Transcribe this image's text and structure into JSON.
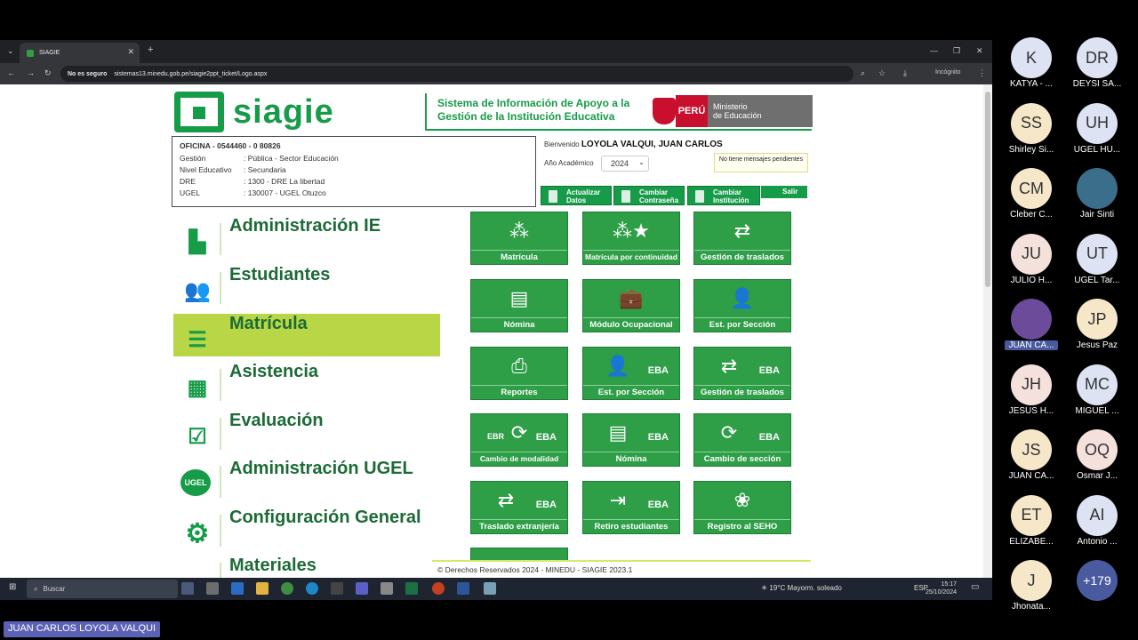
{
  "browser": {
    "tab_title": "SIAGIE",
    "not_secure": "No es seguro",
    "url": "sistemas13.minedu.gob.pe/siagie2ppt_ticket/Logo.aspx",
    "incognito": "Incógnito"
  },
  "header": {
    "logo": "siagie",
    "system_line1": "Sistema de Información de Apoyo a la",
    "system_line2": "Gestión de la Institución Educativa",
    "peru": "PERÚ",
    "ministry_line1": "Ministerio",
    "ministry_line2": "de Educación"
  },
  "office": {
    "title": "OFICINA - 0544460 - 0 80826",
    "rows": [
      {
        "k": "Gestión",
        "v": ": Pública - Sector Educación"
      },
      {
        "k": "Nivel Educativo",
        "v": ": Secundaria"
      },
      {
        "k": "DRE",
        "v": ": 1300 - DRE La libertad"
      },
      {
        "k": "UGEL",
        "v": ": 130007 - UGEL Otuzco"
      }
    ]
  },
  "user": {
    "welcome": "Bienvenido",
    "name": "LOYOLA VALQUI, JUAN CARLOS",
    "year_label": "Año Académico",
    "year": "2024",
    "messages": "No tiene mensajes pendientes"
  },
  "actions": {
    "update_1": "Actualizar",
    "update_2": "Datos",
    "pwd_1": "Cambiar",
    "pwd_2": "Contraseña",
    "inst_1": "Cambiar",
    "inst_2": "Institución",
    "exit": "Salir"
  },
  "menu": [
    {
      "label": "Administración IE",
      "icon": "school-icon"
    },
    {
      "label": "Estudiantes",
      "icon": "students-icon"
    },
    {
      "label": "Matrícula",
      "icon": "enrollment-icon"
    },
    {
      "label": "Asistencia",
      "icon": "attendance-icon"
    },
    {
      "label": "Evaluación",
      "icon": "evaluation-icon"
    },
    {
      "label": "Administración UGEL",
      "icon": "ugel-icon"
    },
    {
      "label": "Configuración General",
      "icon": "gear-icon"
    },
    {
      "label": "Materiales",
      "icon": "materials-icon"
    }
  ],
  "menu_badge": "UGEL",
  "tiles": [
    {
      "label": "Matrícula",
      "eba": ""
    },
    {
      "label": "Matrícula por continuidad",
      "eba": ""
    },
    {
      "label": "Gestión de traslados",
      "eba": ""
    },
    {
      "label": "Nómina",
      "eba": ""
    },
    {
      "label": "Módulo Ocupacional",
      "eba": ""
    },
    {
      "label": "Est. por Sección",
      "eba": ""
    },
    {
      "label": "Reportes",
      "eba": ""
    },
    {
      "label": "Est. por Sección",
      "eba": "EBA"
    },
    {
      "label": "Gestión de traslados",
      "eba": "EBA"
    },
    {
      "label": "Cambio de modalidad",
      "eba": "EBA",
      "ebr": "EBR"
    },
    {
      "label": "Nómina",
      "eba": "EBA"
    },
    {
      "label": "Cambio de sección",
      "eba": "EBA"
    },
    {
      "label": "Traslado extranjería",
      "eba": "EBA"
    },
    {
      "label": "Retiro estudiantes",
      "eba": "EBA"
    },
    {
      "label": "Registro al SEHO",
      "eba": ""
    }
  ],
  "footer": "© Derechos Reservados 2024 - MINEDU - SIAGIE 2023.1",
  "taskbar": {
    "search": "Buscar",
    "weather": "19°C  Mayorm. soleado",
    "lang": "ESP",
    "time": "15:17",
    "date": "25/10/2024"
  },
  "participants": [
    {
      "initials": "K",
      "name": "KATYA - ...",
      "color": "#dde3f3"
    },
    {
      "initials": "DR",
      "name": "DEYSI SA...",
      "color": "#dde3f3"
    },
    {
      "initials": "SS",
      "name": "Shirley Si...",
      "color": "#f6e7c8"
    },
    {
      "initials": "UH",
      "name": "UGEL HU...",
      "color": "#dde3f3"
    },
    {
      "initials": "CM",
      "name": "Cleber C...",
      "color": "#f6e7c8"
    },
    {
      "initials": "",
      "name": "Jair Sinti",
      "color": "#3b6e8a"
    },
    {
      "initials": "JU",
      "name": "JULIO H...",
      "color": "#f5e1dc"
    },
    {
      "initials": "UT",
      "name": "UGEL Tar...",
      "color": "#dde3f3"
    },
    {
      "initials": "",
      "name": "JUAN CA...",
      "color": "#6b4b9a"
    },
    {
      "initials": "JP",
      "name": "Jesus Paz",
      "color": "#f6e7c8"
    },
    {
      "initials": "JH",
      "name": "JESUS H...",
      "color": "#f5e1dc"
    },
    {
      "initials": "MC",
      "name": "MIGUEL ...",
      "color": "#dde3f3"
    },
    {
      "initials": "JS",
      "name": "JUAN CA...",
      "color": "#f6e7c8"
    },
    {
      "initials": "OQ",
      "name": "Osmar J...",
      "color": "#f5e1dc"
    },
    {
      "initials": "ET",
      "name": "ELIZABE...",
      "color": "#f6e7c8"
    },
    {
      "initials": "AI",
      "name": "Antonio ...",
      "color": "#dde3f3"
    },
    {
      "initials": "J",
      "name": "Jhonata...",
      "color": "#f6e7c8"
    },
    {
      "initials": "+179",
      "name": "",
      "color": "#4a5a9e"
    }
  ],
  "active_speaker": "JUAN CARLOS LOYOLA VALQUI"
}
